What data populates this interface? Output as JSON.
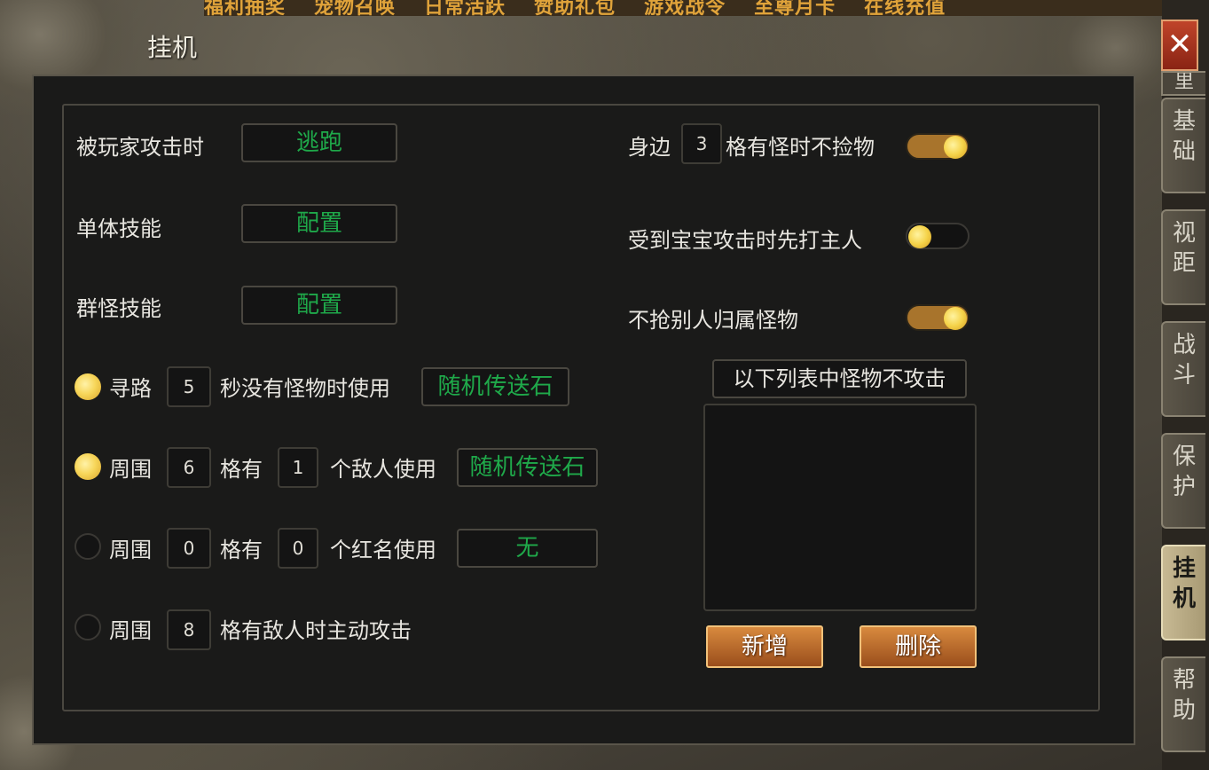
{
  "top_menu": [
    "福利抽奖",
    "宠物召唤",
    "日常活跃",
    "赞助礼包",
    "游戏战令",
    "至尊月卡",
    "在线充值"
  ],
  "window": {
    "title": "挂机",
    "close_icon": "✕"
  },
  "left": {
    "attacked_label": "被玩家攻击时",
    "attacked_value": "逃跑",
    "single_skill_label": "单体技能",
    "single_skill_value": "配置",
    "group_skill_label": "群怪技能",
    "group_skill_value": "配置",
    "rows": [
      {
        "checked": true,
        "prefix": "寻路",
        "n1": "5",
        "mid": "秒没有怪物时使用",
        "item": "随机传送石"
      },
      {
        "checked": true,
        "prefix": "周围",
        "n1": "6",
        "mid": "格有",
        "n2": "1",
        "suffix": "个敌人使用",
        "item": "随机传送石"
      },
      {
        "checked": false,
        "prefix": "周围",
        "n1": "0",
        "mid": "格有",
        "n2": "0",
        "suffix": "个红名使用",
        "item": "无"
      },
      {
        "checked": false,
        "prefix": "周围",
        "n1": "8",
        "mid": "格有敌人时主动攻击"
      }
    ]
  },
  "right": {
    "pickup_prefix": "身边",
    "pickup_range": "3",
    "pickup_suffix": "格有怪时不捡物",
    "pickup_on": true,
    "pet_attack_label": "受到宝宝攻击时先打主人",
    "pet_attack_on": false,
    "no_steal_label": "不抢别人归属怪物",
    "no_steal_on": true,
    "list_title": "以下列表中怪物不攻击",
    "add_button": "新增",
    "delete_button": "删除"
  },
  "tabs": [
    {
      "label": "基础",
      "active": false
    },
    {
      "label": "视距",
      "active": false
    },
    {
      "label": "战斗",
      "active": false
    },
    {
      "label": "保护",
      "active": false
    },
    {
      "label": "挂机",
      "active": true
    },
    {
      "label": "帮助",
      "active": false
    }
  ],
  "tabs_top_partial": "里",
  "colors": {
    "accent_green": "#1fa94a",
    "toggle_on": "#a8742c",
    "button_orange": "#c9772f"
  }
}
